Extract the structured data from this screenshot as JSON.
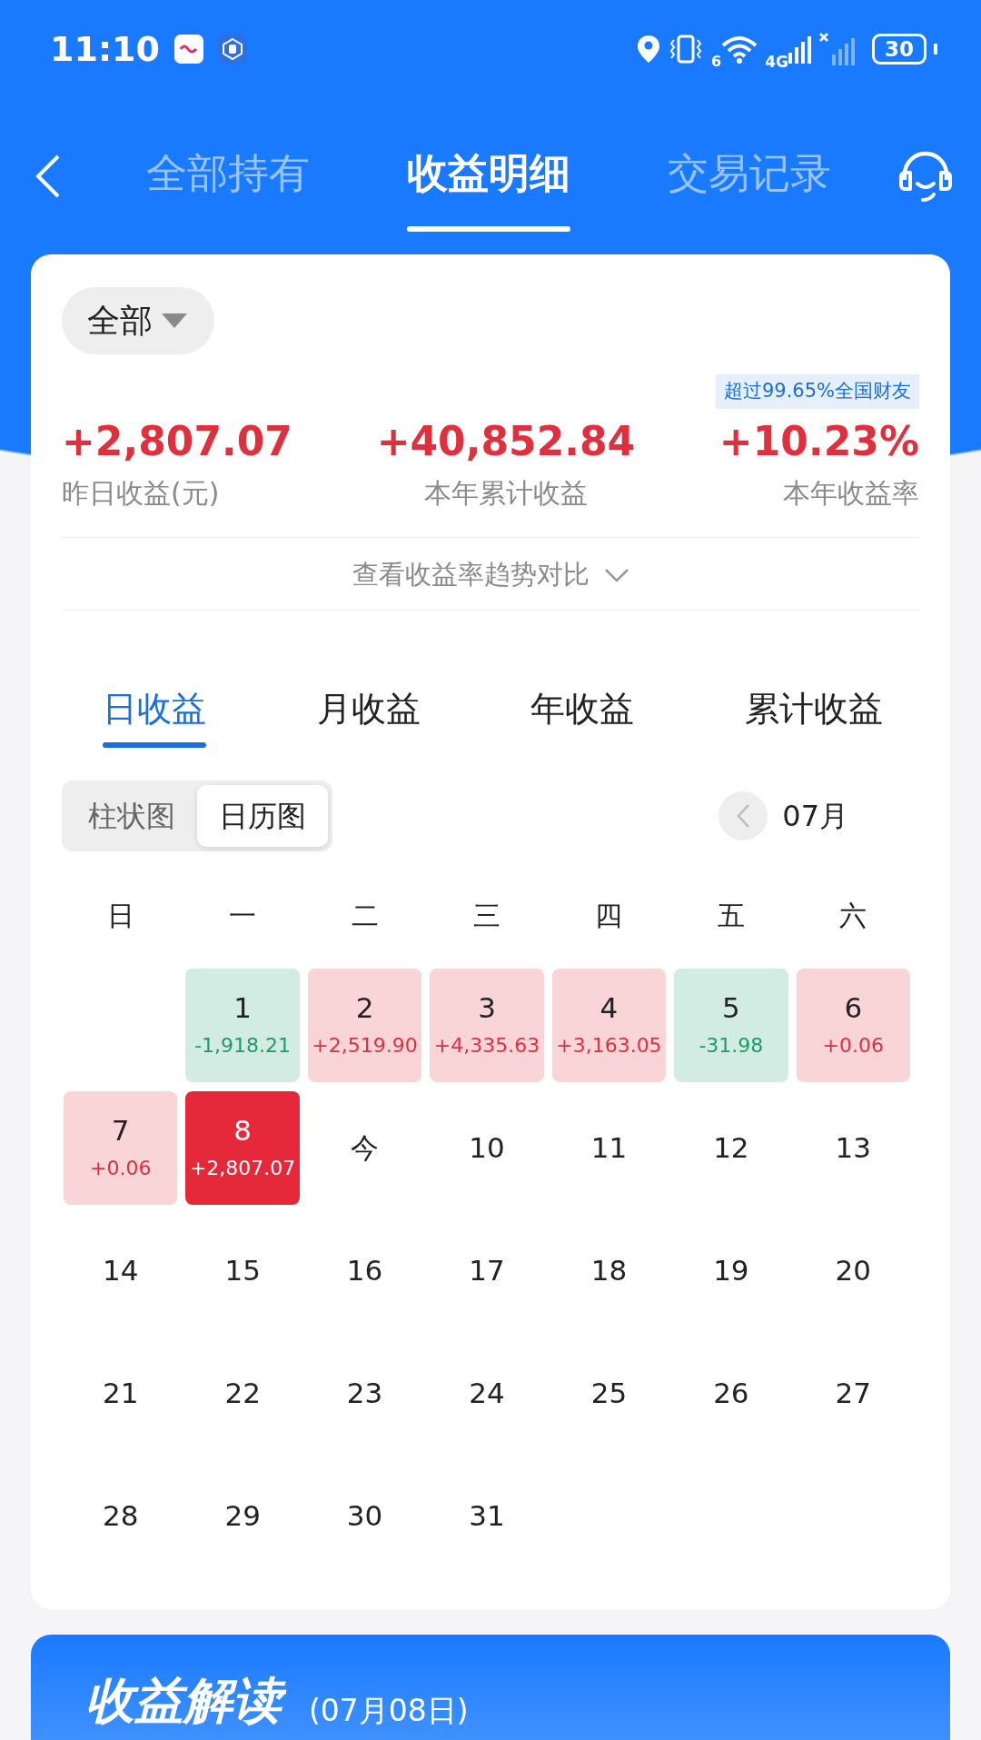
{
  "status_bar": {
    "time": "11:10",
    "wifi_badge": "6",
    "network": "4G",
    "battery": "30"
  },
  "header": {
    "tabs": [
      {
        "label": "全部持有",
        "selected": false
      },
      {
        "label": "收益明细",
        "selected": true
      },
      {
        "label": "交易记录",
        "selected": false
      }
    ]
  },
  "filter": {
    "label": "全部"
  },
  "rank_badge": "超过99.65%全国财友",
  "summary": [
    {
      "value": "+2,807.07",
      "label": "昨日收益(元)"
    },
    {
      "value": "+40,852.84",
      "label": "本年累计收益"
    },
    {
      "value": "+10.23%",
      "label": "本年收益率"
    }
  ],
  "trend_toggle": {
    "label": "查看收益率趋势对比"
  },
  "period_tabs": [
    {
      "label": "日收益",
      "selected": true
    },
    {
      "label": "月收益",
      "selected": false
    },
    {
      "label": "年收益",
      "selected": false
    },
    {
      "label": "累计收益",
      "selected": false
    }
  ],
  "view_switch": [
    {
      "label": "柱状图",
      "selected": false
    },
    {
      "label": "日历图",
      "selected": true
    }
  ],
  "month": "07月",
  "weekdays": [
    "日",
    "一",
    "二",
    "三",
    "四",
    "五",
    "六"
  ],
  "calendar": [
    {
      "kind": "blank"
    },
    {
      "kind": "loss",
      "day": "1",
      "amount": "-1,918.21",
      "selected": false
    },
    {
      "kind": "gain",
      "day": "2",
      "amount": "+2,519.90",
      "selected": false
    },
    {
      "kind": "gain",
      "day": "3",
      "amount": "+4,335.63",
      "selected": false
    },
    {
      "kind": "gain",
      "day": "4",
      "amount": "+3,163.05",
      "selected": false
    },
    {
      "kind": "loss",
      "day": "5",
      "amount": "-31.98",
      "selected": false
    },
    {
      "kind": "gain",
      "day": "6",
      "amount": "+0.06",
      "selected": false
    },
    {
      "kind": "gain",
      "day": "7",
      "amount": "+0.06",
      "selected": false
    },
    {
      "kind": "gain",
      "day": "8",
      "amount": "+2,807.07",
      "selected": true
    },
    {
      "kind": "day",
      "day": "今",
      "selected": false
    },
    {
      "kind": "day",
      "day": "10",
      "selected": false
    },
    {
      "kind": "day",
      "day": "11",
      "selected": false
    },
    {
      "kind": "day",
      "day": "12",
      "selected": false
    },
    {
      "kind": "day",
      "day": "13",
      "selected": false
    },
    {
      "kind": "day",
      "day": "14",
      "selected": false
    },
    {
      "kind": "day",
      "day": "15",
      "selected": false
    },
    {
      "kind": "day",
      "day": "16",
      "selected": false
    },
    {
      "kind": "day",
      "day": "17",
      "selected": false
    },
    {
      "kind": "day",
      "day": "18",
      "selected": false
    },
    {
      "kind": "day",
      "day": "19",
      "selected": false
    },
    {
      "kind": "day",
      "day": "20",
      "selected": false
    },
    {
      "kind": "day",
      "day": "21",
      "selected": false
    },
    {
      "kind": "day",
      "day": "22",
      "selected": false
    },
    {
      "kind": "day",
      "day": "23",
      "selected": false
    },
    {
      "kind": "day",
      "day": "24",
      "selected": false
    },
    {
      "kind": "day",
      "day": "25",
      "selected": false
    },
    {
      "kind": "day",
      "day": "26",
      "selected": false
    },
    {
      "kind": "day",
      "day": "27",
      "selected": false
    },
    {
      "kind": "day",
      "day": "28",
      "selected": false
    },
    {
      "kind": "day",
      "day": "29",
      "selected": false
    },
    {
      "kind": "day",
      "day": "30",
      "selected": false
    },
    {
      "kind": "day",
      "day": "31",
      "selected": false
    }
  ],
  "insight": {
    "title": "收益解读",
    "date": "(07月08日)"
  }
}
